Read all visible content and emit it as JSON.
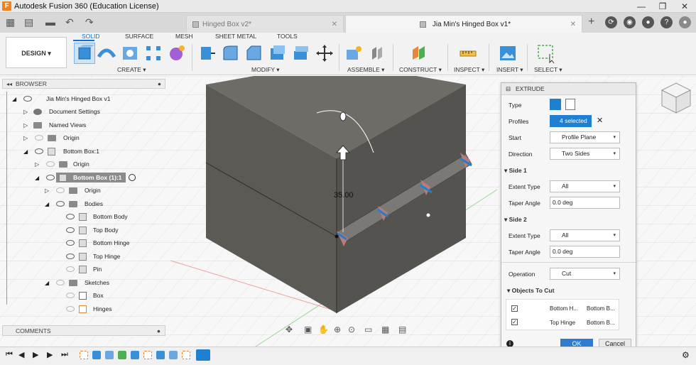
{
  "window": {
    "title": "Autodesk Fusion 360 (Education License)",
    "logo_letter": "F",
    "minimize": "—",
    "restore": "❐",
    "close": "✕"
  },
  "tabs": [
    {
      "label": "Hinged Box v2*",
      "active": false
    },
    {
      "label": "Jia Min's Hinged Box v1*",
      "active": true
    }
  ],
  "tab_close": "✕",
  "ribbon": {
    "design_label": "DESIGN ▾",
    "tabs": [
      "SOLID",
      "SURFACE",
      "MESH",
      "SHEET METAL",
      "TOOLS"
    ],
    "groups": [
      "CREATE ▾",
      "MODIFY ▾",
      "ASSEMBLE ▾",
      "CONSTRUCT ▾",
      "INSPECT ▾",
      "INSERT ▾",
      "SELECT ▾"
    ]
  },
  "browser": {
    "title": "BROWSER",
    "items": [
      {
        "label": "Jia Min's Hinged Box v1"
      },
      {
        "label": "Document Settings"
      },
      {
        "label": "Named Views"
      },
      {
        "label": "Origin"
      },
      {
        "label": "Bottom Box:1"
      },
      {
        "label": "Origin"
      },
      {
        "label": "Bottom Box (1):1"
      },
      {
        "label": "Origin"
      },
      {
        "label": "Bodies"
      },
      {
        "label": "Bottom Body"
      },
      {
        "label": "Top Body"
      },
      {
        "label": "Bottom Hinge"
      },
      {
        "label": "Top Hinge"
      },
      {
        "label": "Pin"
      },
      {
        "label": "Sketches"
      },
      {
        "label": "Box"
      },
      {
        "label": "Hinges"
      }
    ]
  },
  "comments": {
    "title": "COMMENTS"
  },
  "viewport": {
    "dimension": "35.00"
  },
  "extrude": {
    "title": "EXTRUDE",
    "type_label": "Type",
    "profiles_label": "Profiles",
    "profiles_value": "4 selected",
    "start_label": "Start",
    "start_value": "Profile Plane",
    "direction_label": "Direction",
    "direction_value": "Two Sides",
    "side1_label": "Side 1",
    "side1_extent_label": "Extent Type",
    "side1_extent_value": "All",
    "side1_taper_label": "Taper Angle",
    "side1_taper_value": "0.0 deg",
    "side2_label": "Side 2",
    "side2_extent_label": "Extent Type",
    "side2_extent_value": "All",
    "side2_taper_label": "Taper Angle",
    "side2_taper_value": "0.0 deg",
    "operation_label": "Operation",
    "operation_value": "Cut",
    "objects_label": "Objects To Cut",
    "objects": [
      {
        "c1": "Bottom H...",
        "c2": "Bottom B..."
      },
      {
        "c1": "Top Hinge",
        "c2": "Bottom B..."
      }
    ],
    "ok": "OK",
    "cancel": "Cancel"
  },
  "colors": {
    "accent": "#0a74da",
    "body": "#5c5a55",
    "selected": "#1f7fd0"
  }
}
